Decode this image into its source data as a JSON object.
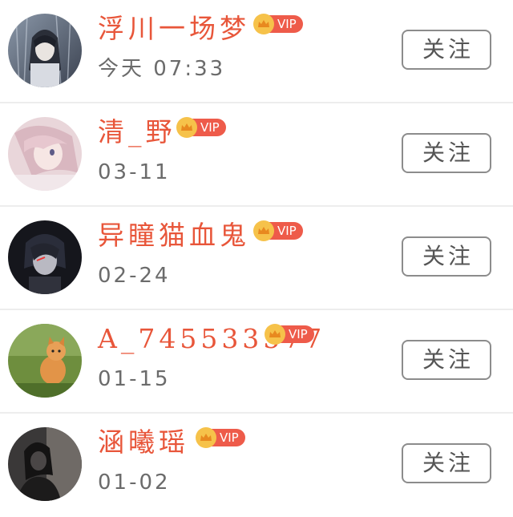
{
  "users": [
    {
      "name": "浮川一场梦",
      "time": "今天 07:33",
      "badge": "VIP",
      "follow_label": "关注",
      "avatar_icon": "anime-boy-rain-avatar"
    },
    {
      "name": "清_野",
      "time": "03-11",
      "badge": "VIP",
      "follow_label": "关注",
      "avatar_icon": "anime-girl-pink-avatar"
    },
    {
      "name": "异瞳猫血鬼",
      "time": "02-24",
      "badge": "VIP",
      "follow_label": "关注",
      "avatar_icon": "dark-anime-boy-avatar"
    },
    {
      "name": "A_745533577",
      "time": "01-15",
      "badge": "VIP",
      "follow_label": "关注",
      "avatar_icon": "orange-kitten-avatar"
    },
    {
      "name": "涵曦瑶",
      "time": "01-02",
      "badge": "VIP",
      "follow_label": "关注",
      "avatar_icon": "silhouette-girl-avatar"
    }
  ],
  "colors": {
    "name": "#e8563a",
    "vip_badge": "#ee5b4a",
    "vip_crown": "#f6c24a",
    "time": "#6b6b6b",
    "button_border": "#8c8c8c"
  }
}
